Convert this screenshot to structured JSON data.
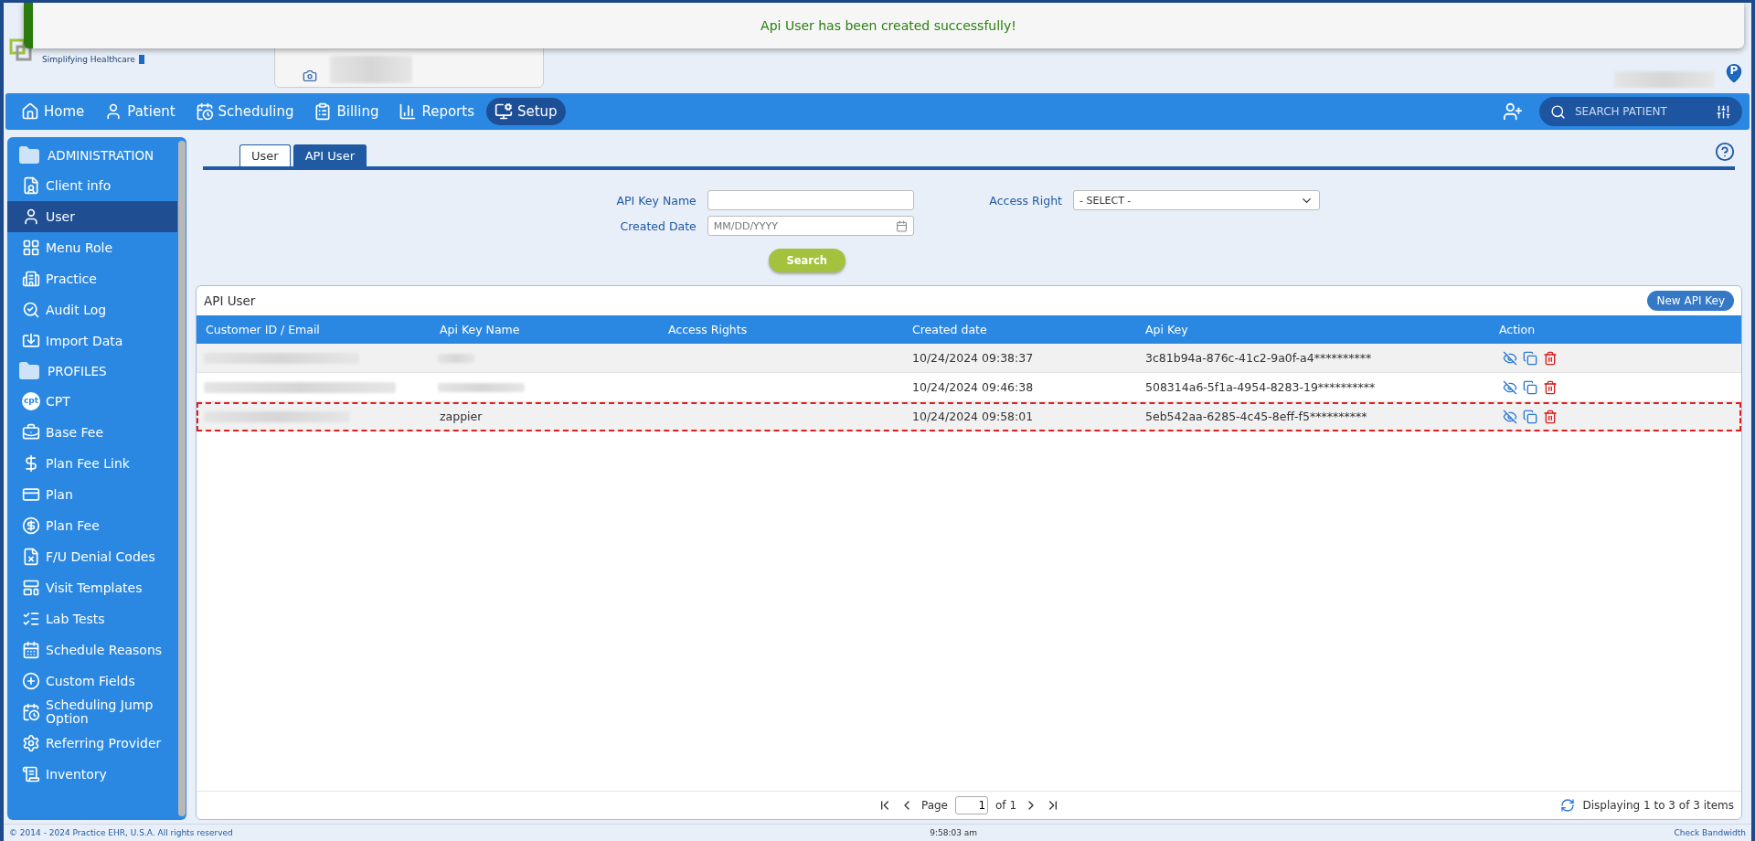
{
  "toast": {
    "message": "Api User has been created successfully!"
  },
  "header": {
    "tagline": "Simplifying Healthcare",
    "location_pin": "P"
  },
  "nav": {
    "items": [
      {
        "label": "Home",
        "selected": false
      },
      {
        "label": "Patient",
        "selected": false
      },
      {
        "label": "Scheduling",
        "selected": false
      },
      {
        "label": "Billing",
        "selected": false
      },
      {
        "label": "Reports",
        "selected": false
      },
      {
        "label": "Setup",
        "selected": true
      }
    ],
    "search_placeholder": "SEARCH PATIENT"
  },
  "sidebar": {
    "sections": [
      {
        "title": "ADMINISTRATION",
        "items": [
          {
            "label": "Client info",
            "selected": false
          },
          {
            "label": "User",
            "selected": true
          },
          {
            "label": "Menu Role",
            "selected": false
          },
          {
            "label": "Practice",
            "selected": false
          },
          {
            "label": "Audit Log",
            "selected": false
          },
          {
            "label": "Import Data",
            "selected": false
          }
        ]
      },
      {
        "title": "PROFILES",
        "items": [
          {
            "label": "CPT",
            "selected": false,
            "icon_text": "cpt"
          },
          {
            "label": "Base Fee",
            "selected": false
          },
          {
            "label": "Plan Fee Link",
            "selected": false
          },
          {
            "label": "Plan",
            "selected": false
          },
          {
            "label": "Plan Fee",
            "selected": false
          },
          {
            "label": "F/U Denial Codes",
            "selected": false
          },
          {
            "label": "Visit Templates",
            "selected": false
          },
          {
            "label": "Lab Tests",
            "selected": false
          },
          {
            "label": "Schedule Reasons",
            "selected": false
          },
          {
            "label": "Custom Fields",
            "selected": false
          },
          {
            "label": "Scheduling Jump Option",
            "selected": false
          },
          {
            "label": "Referring Provider",
            "selected": false
          },
          {
            "label": "Inventory",
            "selected": false
          }
        ]
      }
    ]
  },
  "tabs": [
    {
      "label": "User",
      "selected": false
    },
    {
      "label": "API User",
      "selected": true
    }
  ],
  "filters": {
    "api_key_name": {
      "label": "API Key Name"
    },
    "created_date": {
      "label": "Created Date",
      "placeholder": "MM/DD/YYYY"
    },
    "access_right": {
      "label": "Access Right",
      "value": "- SELECT -"
    },
    "search_button": "Search"
  },
  "grid": {
    "title": "API User",
    "new_button": "New API Key",
    "columns": [
      "Customer ID / Email",
      "Api Key Name",
      "Access Rights",
      "Created date",
      "Api Key",
      "Action"
    ],
    "rows": [
      {
        "created": "10/24/2024 09:38:37",
        "api_key": "3c81b94a-876c-41c2-9a0f-a4**********",
        "highlighted": false
      },
      {
        "created": "10/24/2024 09:46:38",
        "api_key": "508314a6-5f1a-4954-8283-19**********",
        "highlighted": false
      },
      {
        "api_key_name": "zappier",
        "created": "10/24/2024 09:58:01",
        "api_key": "5eb542aa-6285-4c45-8eff-f5**********",
        "highlighted": true
      }
    ],
    "pager": {
      "page_label": "Page",
      "page": "1",
      "of": "of 1",
      "status": "Displaying 1 to 3 of 3 items"
    }
  },
  "footer": {
    "copyright": "© 2014 - 2024 Practice EHR, U.S.A. All rights reserved",
    "time": "9:58:03 am",
    "link": "Check Bandwidth"
  }
}
